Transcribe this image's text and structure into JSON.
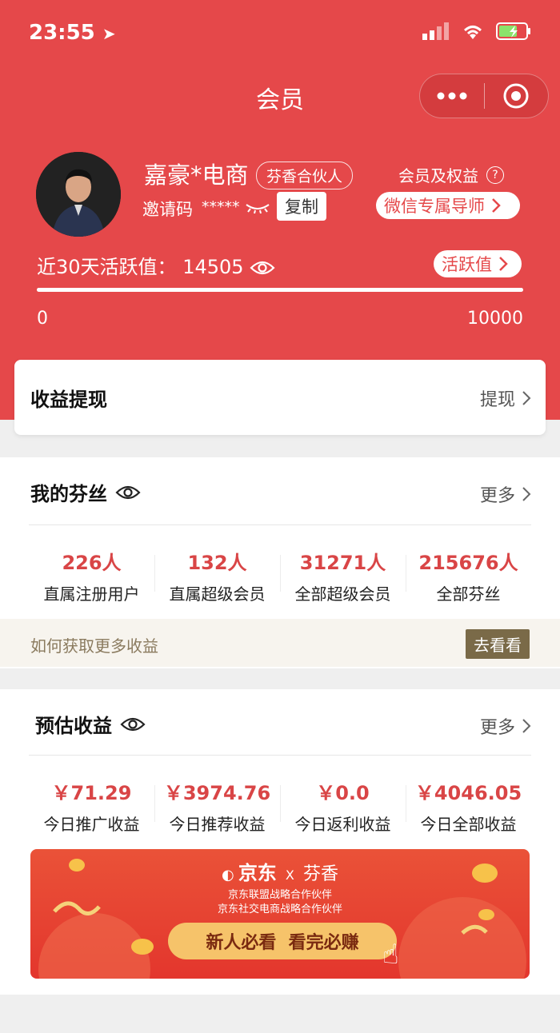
{
  "status_bar": {
    "time": "23:55"
  },
  "nav": {
    "title": "会员"
  },
  "profile": {
    "name": "嘉豪*电商",
    "tag": "芬香合伙人",
    "invite_label": "邀请码",
    "invite_code": "*****",
    "copy_label": "复制",
    "rights_label": "会员及权益",
    "guide_label": "微信专属导师"
  },
  "activity": {
    "label": "近30天活跃值：",
    "value": "14505",
    "button_label": "活跃值",
    "axis_min": "0",
    "axis_max": "10000",
    "progress_fraction": 1.0
  },
  "withdraw": {
    "title": "收益提现",
    "action_label": "提现"
  },
  "fans": {
    "title": "我的芬丝",
    "more_label": "更多",
    "stats": [
      {
        "value": "226人",
        "label": "直属注册用户"
      },
      {
        "value": "132人",
        "label": "直属超级会员"
      },
      {
        "value": "31271人",
        "label": "全部超级会员"
      },
      {
        "value": "215676人",
        "label": "全部芬丝"
      }
    ],
    "tip_text": "如何获取更多收益",
    "tip_button": "去看看"
  },
  "earnings": {
    "title": "预估收益",
    "more_label": "更多",
    "stats": [
      {
        "value": "￥71.29",
        "label": "今日推广收益"
      },
      {
        "value": "￥3974.76",
        "label": "今日推荐收益"
      },
      {
        "value": "￥0.0",
        "label": "今日返利收益"
      },
      {
        "value": "￥4046.05",
        "label": "今日全部收益"
      }
    ]
  },
  "banner": {
    "brand_left": "京东",
    "brand_x": "X",
    "brand_right": "芬香",
    "line1": "京东联盟战略合作伙伴",
    "line2": "京东社交电商战略合作伙伴",
    "cta": "新人必看  看完必赚"
  },
  "colors": {
    "primary_red": "#e5484a",
    "value_red": "#d94546",
    "tip_button": "#7a6a48"
  }
}
